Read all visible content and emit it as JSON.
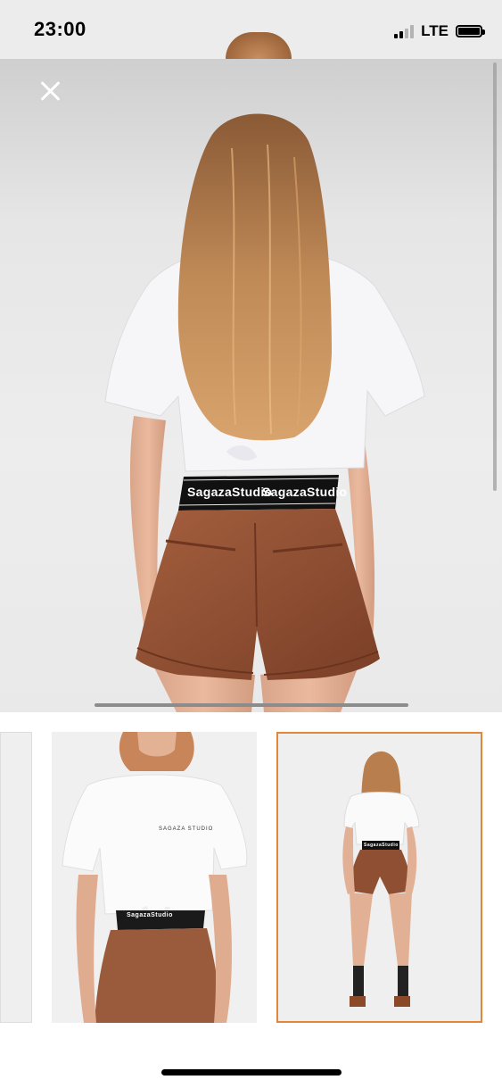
{
  "status_bar": {
    "time": "23:00",
    "network": "LTE",
    "signal_bars_active": 2,
    "signal_bars_total": 4
  },
  "gallery": {
    "selected_index": 2,
    "brand_band_text": "SagazaStudio",
    "thumb_tee_text": "SAGAZA STUDIO",
    "thumbnails": [
      {
        "view": "partial"
      },
      {
        "view": "front"
      },
      {
        "view": "back-full"
      }
    ]
  },
  "icons": {
    "close": "close-icon"
  },
  "colors": {
    "selected_border": "#e2863a",
    "shorts": "#8f4f33",
    "background": "#ffffff"
  }
}
